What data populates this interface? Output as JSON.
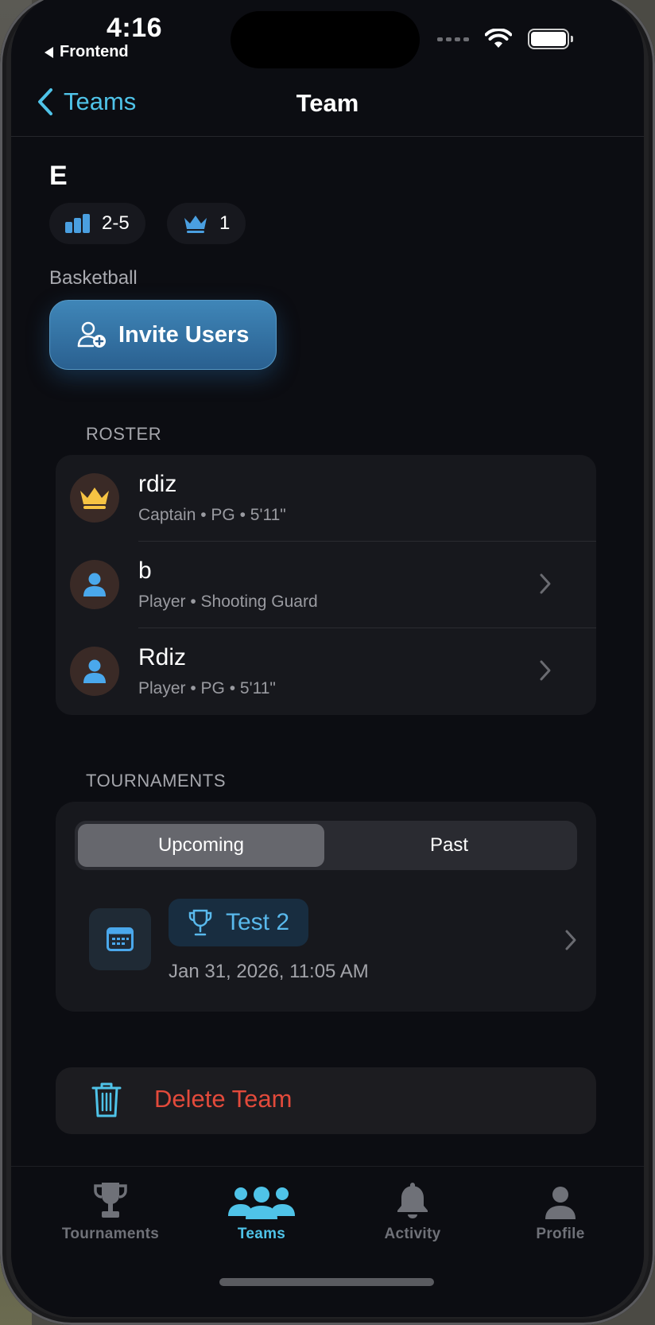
{
  "status_bar": {
    "time": "4:16",
    "back_app": "Frontend"
  },
  "nav": {
    "back_label": "Teams",
    "title": "Team"
  },
  "team": {
    "name": "E",
    "record": "2-5",
    "captain_count": "1",
    "sport": "Basketball",
    "invite_label": "Invite Users"
  },
  "roster": {
    "header": "ROSTER",
    "members": [
      {
        "name": "rdiz",
        "subtitle": "Captain • PG • 5'11\"",
        "role_icon": "crown-icon"
      },
      {
        "name": "b",
        "subtitle": "Player • Shooting Guard",
        "role_icon": "person-icon"
      },
      {
        "name": "Rdiz",
        "subtitle": "Player • PG • 5'11\"",
        "role_icon": "person-icon"
      }
    ]
  },
  "tournaments": {
    "header": "TOURNAMENTS",
    "segments": [
      "Upcoming",
      "Past"
    ],
    "selected_segment": "Upcoming",
    "items": [
      {
        "name": "Test 2",
        "date": "Jan 31, 2026, 11:05 AM"
      }
    ]
  },
  "delete": {
    "label": "Delete Team"
  },
  "tab_bar": {
    "tabs": [
      {
        "label": "Tournaments",
        "icon": "trophy-icon"
      },
      {
        "label": "Teams",
        "icon": "people-icon"
      },
      {
        "label": "Activity",
        "icon": "bell-icon"
      },
      {
        "label": "Profile",
        "icon": "person-icon"
      }
    ],
    "active": "Teams"
  },
  "colors": {
    "accent": "#4fc3e8",
    "destructive": "#e24a3b",
    "crown": "#f6c343",
    "background": "#0c0d12",
    "card": "#17181d"
  }
}
